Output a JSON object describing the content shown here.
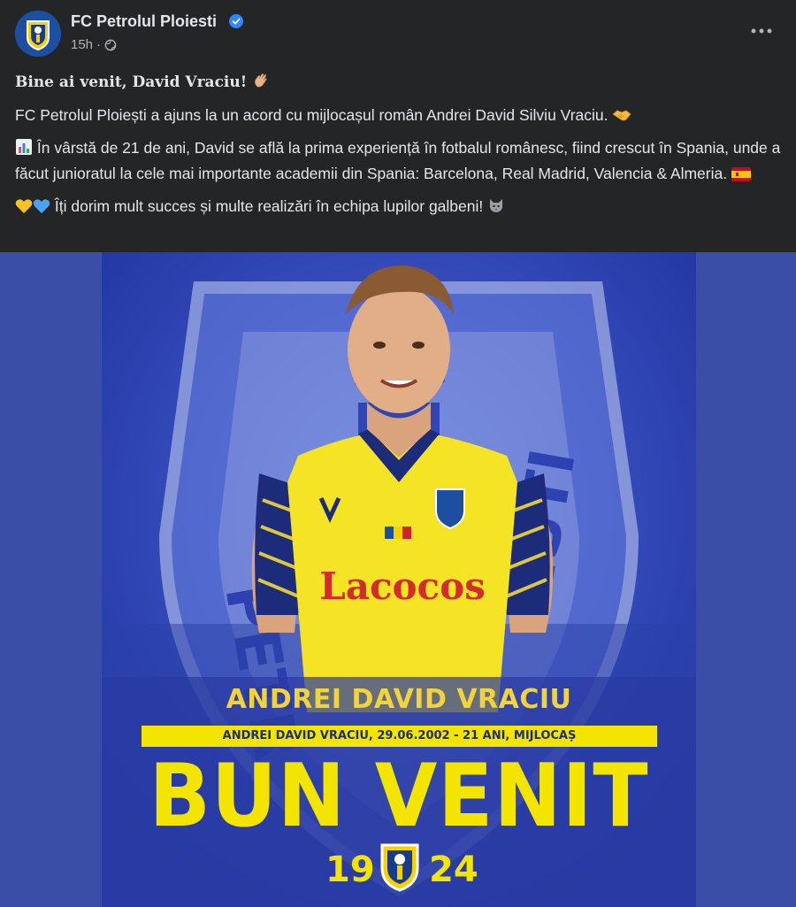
{
  "post": {
    "page_name": "FC Petrolul Ploiesti",
    "time": "15h",
    "separator": "·",
    "title": "Bine ai venit, David Vraciu!",
    "paragraph1": "FC Petrolul Ploiești a ajuns la un acord cu mijlocașul român Andrei David Silviu Vraciu.",
    "paragraph2": "În vârstă de 21 de ani, David se află la prima experiență în fotbalul românesc, fiind crescut în Spania, unde a făcut junioratul la cele mai importante academii din Spania: Barcelona, Real Madrid, Valencia & Almeria.",
    "paragraph3": "Îți dorim mult succes și multe realizări în echipa lupilor galbeni!"
  },
  "icons": {
    "verified": "verified-badge-icon",
    "globe": "globe-icon",
    "more": "more-options-icon"
  },
  "poster": {
    "player_name": "ANDREI DAVID VRACIU",
    "info": "ANDREI DAVID VRACIU, 29.06.2002 - 21 ANI, MIJLOCAȘ",
    "headline": "BUN VENIT",
    "year_left": "19",
    "year_right": "24",
    "background_crest_text": "FC PETROLUL PLOIESTI",
    "jersey_sponsor": "Lacocos"
  },
  "colors": {
    "background": "#242526",
    "text": "#e4e6eb",
    "muted": "#b0b3b8",
    "verified": "#2d88ff",
    "poster_blue": "#2a3fa8",
    "poster_yellow": "#f4e500"
  }
}
